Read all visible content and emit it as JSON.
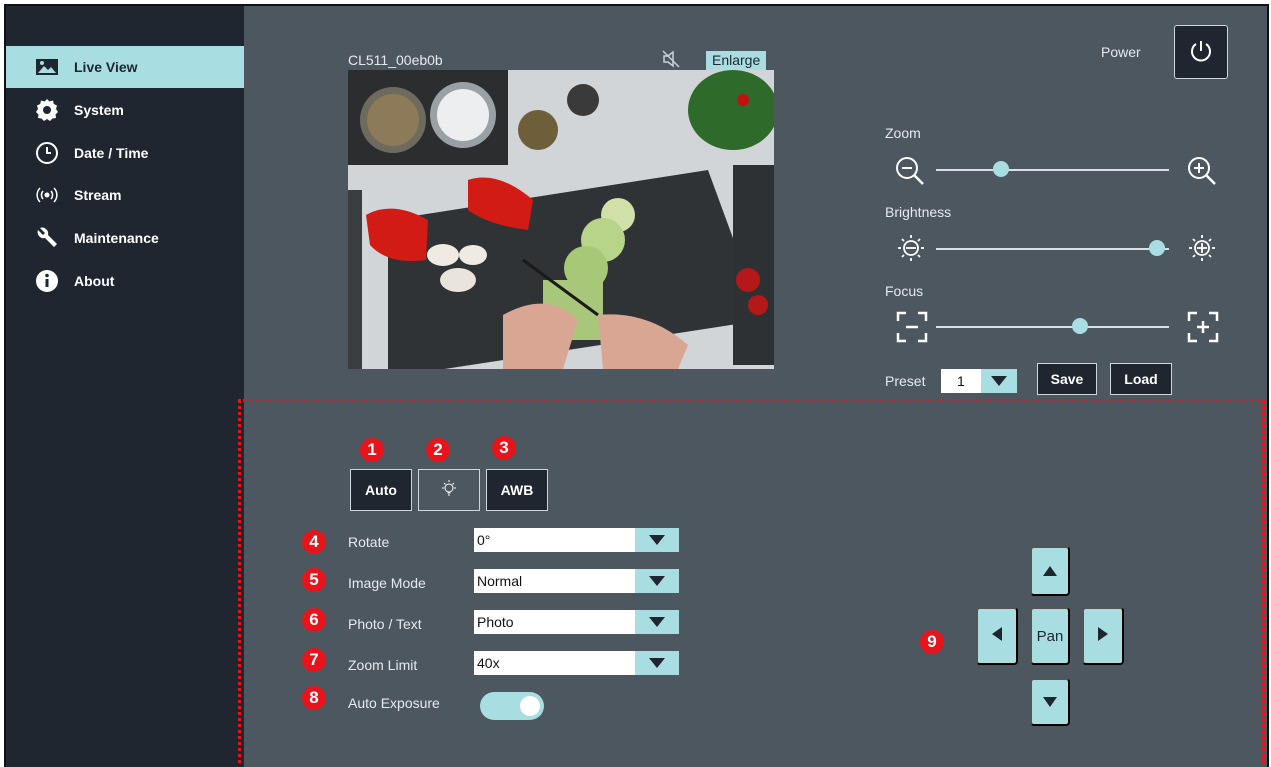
{
  "sidebar": {
    "items": [
      {
        "label": "Live View",
        "icon": "image-icon",
        "active": true
      },
      {
        "label": "System",
        "icon": "gear-icon",
        "active": false
      },
      {
        "label": "Date / Time",
        "icon": "clock-icon",
        "active": false
      },
      {
        "label": "Stream",
        "icon": "broadcast-icon",
        "active": false
      },
      {
        "label": "Maintenance",
        "icon": "wrench-icon",
        "active": false
      },
      {
        "label": "About",
        "icon": "info-icon",
        "active": false
      }
    ]
  },
  "camera": {
    "title": "CL511_00eb0b",
    "enlarge_label": "Enlarge",
    "mute_icon": "speaker-muted-icon"
  },
  "power": {
    "label": "Power"
  },
  "controls": {
    "zoom": {
      "label": "Zoom",
      "value": 0.28
    },
    "brightness": {
      "label": "Brightness",
      "value": 0.95
    },
    "focus": {
      "label": "Focus",
      "value": 0.62
    }
  },
  "preset": {
    "label": "Preset",
    "selected": "1",
    "save_label": "Save",
    "load_label": "Load"
  },
  "mode_buttons": {
    "auto": "Auto",
    "awb": "AWB"
  },
  "settings": {
    "rotate": {
      "label": "Rotate",
      "value": "0°"
    },
    "image_mode": {
      "label": "Image Mode",
      "value": "Normal"
    },
    "photo_text": {
      "label": "Photo / Text",
      "value": "Photo"
    },
    "zoom_limit": {
      "label": "Zoom Limit",
      "value": "40x"
    },
    "auto_exposure": {
      "label": "Auto Exposure",
      "on": true
    }
  },
  "pan": {
    "label": "Pan"
  },
  "badges": [
    "1",
    "2",
    "3",
    "4",
    "5",
    "6",
    "7",
    "8",
    "9"
  ],
  "colors": {
    "accent": "#a8dde2",
    "sidebar": "#1f2630",
    "panel": "#4d575f",
    "annotation": "#e8141b"
  }
}
